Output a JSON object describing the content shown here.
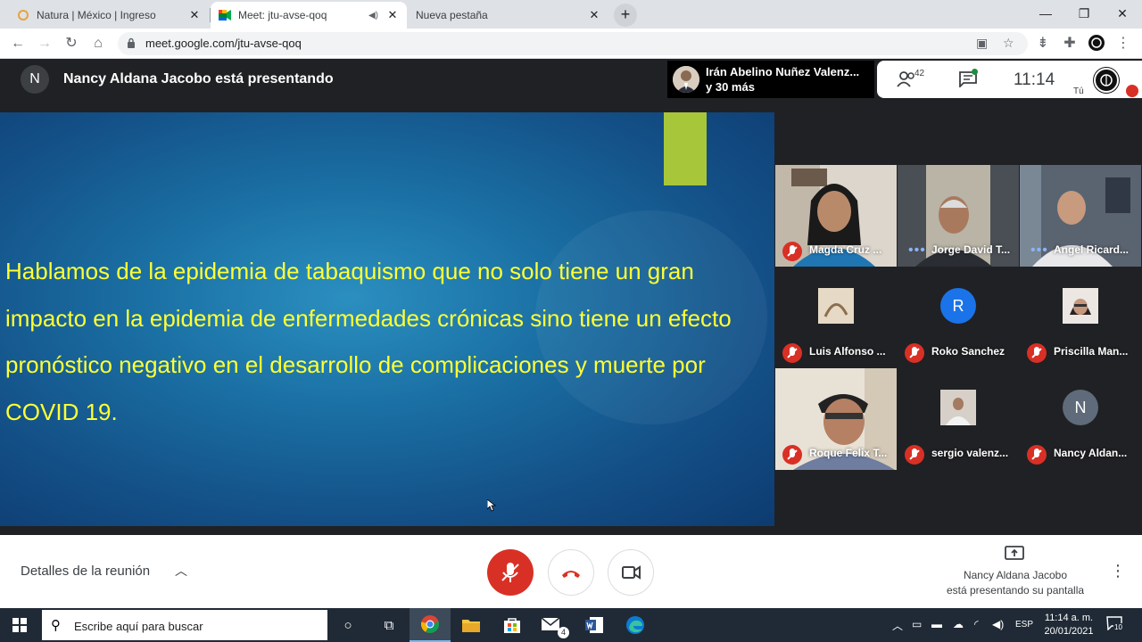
{
  "browser": {
    "tabs": [
      {
        "title": "Natura | México | Ingreso",
        "active": false
      },
      {
        "title": "Meet: jtu-avse-qoq",
        "active": true
      },
      {
        "title": "Nueva pestaña",
        "active": false
      }
    ],
    "close_glyph": "✕",
    "new_tab_glyph": "+",
    "url": "meet.google.com/jtu-avse-qoq"
  },
  "meet": {
    "presenter_initial": "N",
    "presenter_text": "Nancy Aldana Jacobo está presentando",
    "active_speaker_name": "Irán Abelino Nuñez Valenz...",
    "active_speaker_more": "y 30 más",
    "people_count": "42",
    "clock": "11:14",
    "self_label": "Tú"
  },
  "slide": {
    "text": "Hablamos de la epidemia de tabaquismo que no solo tiene un gran impacto en la epidemia de enfermedades crónicas sino tiene un efecto pronóstico negativo en el desarrollo de complicaciones y muerte por COVID 19.",
    "text_color": "#ffff33",
    "accent_color": "#a8c63a"
  },
  "participants": [
    {
      "name": "Magda Cruz ...",
      "muted": true
    },
    {
      "name": "Jorge David T...",
      "muted": false
    },
    {
      "name": "Angel Ricard...",
      "muted": false
    },
    {
      "name": "Luis Alfonso ...",
      "muted": true
    },
    {
      "name": "Roko Sanchez",
      "muted": true,
      "initial": "R"
    },
    {
      "name": "Priscilla Man...",
      "muted": true
    },
    {
      "name": "Roque Felix T...",
      "muted": true
    },
    {
      "name": "sergio valenz...",
      "muted": true
    },
    {
      "name": "Nancy Aldan...",
      "muted": true,
      "initial": "N"
    }
  ],
  "controls": {
    "details_label": "Detalles de la reunión",
    "presenting_line1": "Nancy Aldana Jacobo",
    "presenting_line2": "está presentando su pantalla"
  },
  "taskbar": {
    "search_placeholder": "Escribe aquí para buscar",
    "mail_badge": "4",
    "language": "ESP",
    "time": "11:14 a. m.",
    "date": "20/01/2021",
    "notifications": "10"
  },
  "colors": {
    "meet_red": "#d93025",
    "meet_dark": "#202124",
    "taskbar": "#202a36"
  }
}
